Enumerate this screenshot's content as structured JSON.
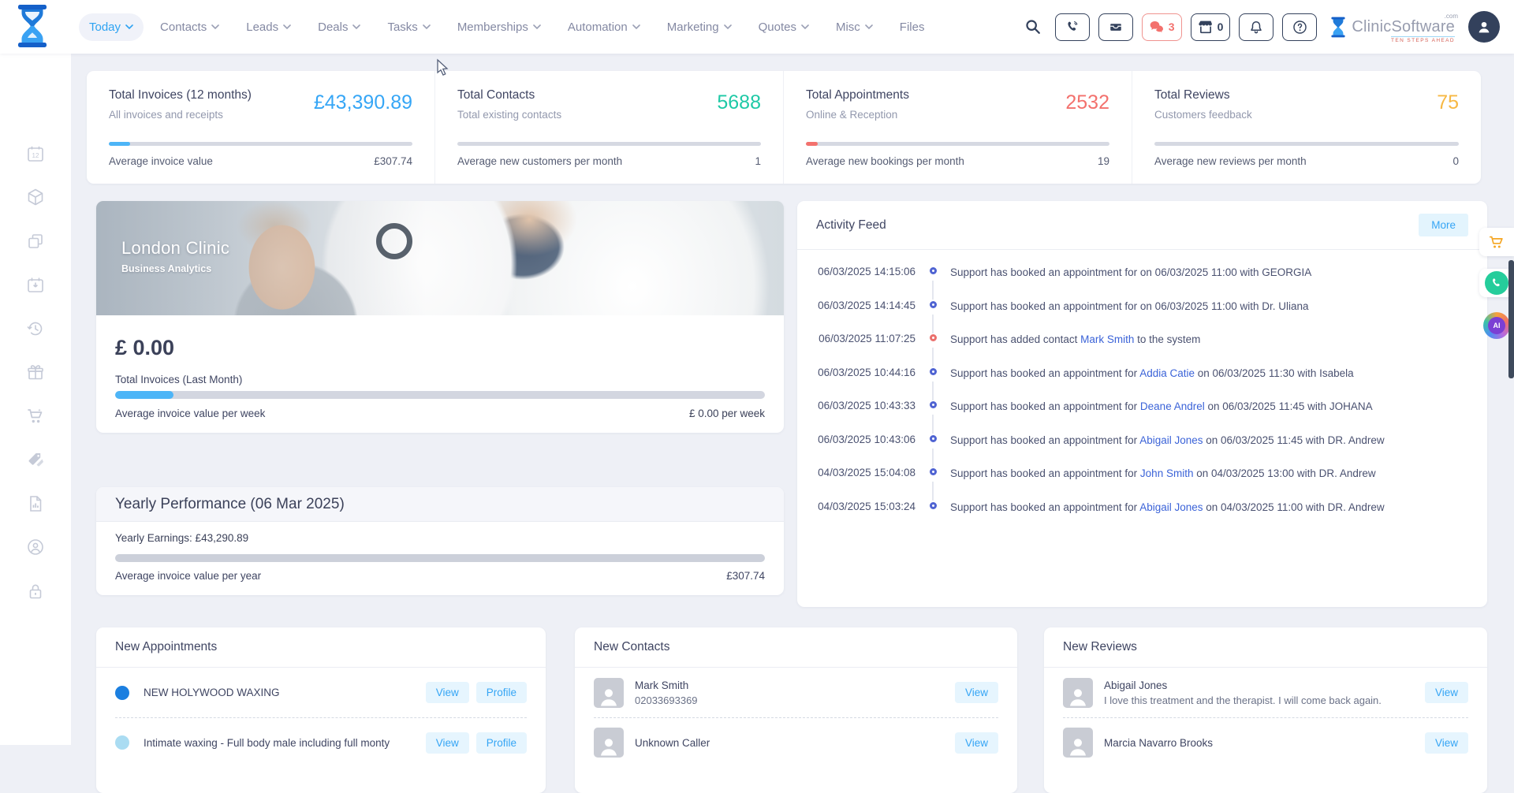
{
  "header": {
    "nav": [
      {
        "label": "Today"
      },
      {
        "label": "Contacts"
      },
      {
        "label": "Leads"
      },
      {
        "label": "Deals"
      },
      {
        "label": "Tasks"
      },
      {
        "label": "Memberships"
      },
      {
        "label": "Automation"
      },
      {
        "label": "Marketing"
      },
      {
        "label": "Quotes"
      },
      {
        "label": "Misc"
      },
      {
        "label": "Files"
      }
    ],
    "chat_badge": "3",
    "shop_badge": "0",
    "brand": {
      "name": "ClinicSoftware",
      "tld": ".com",
      "tagline": "TEN STEPS AHEAD"
    },
    "icons": [
      "search-icon",
      "phone-icon",
      "inbox-icon",
      "chat-icon",
      "shop-icon",
      "bell-icon",
      "help-icon",
      "user-avatar-icon"
    ],
    "accent_color": "#2ea3f2"
  },
  "sidebar": {
    "icons": [
      "calendar-12",
      "package",
      "copy",
      "calendar-import",
      "history",
      "gift",
      "cart",
      "tags",
      "report",
      "account",
      "lock"
    ]
  },
  "stats": {
    "cards": [
      {
        "title": "Total Invoices (12 months)",
        "subtitle": "All invoices and receipts",
        "value": "£43,390.89",
        "value_color": "#36a6f6",
        "bar_pct": 7,
        "bar_color": "#4db5f7",
        "footer_label": "Average invoice value",
        "footer_value": "£307.74"
      },
      {
        "title": "Total Contacts",
        "subtitle": "Total existing contacts",
        "value": "5688",
        "value_color": "#1ec9a6",
        "bar_pct": 0,
        "bar_color": "#1ec9a6",
        "footer_label": "Average new customers per month",
        "footer_value": "1"
      },
      {
        "title": "Total Appointments",
        "subtitle": "Online & Reception",
        "value": "2532",
        "value_color": "#f3716d",
        "bar_pct": 4,
        "bar_color": "#f3716d",
        "footer_label": "Average new bookings per month",
        "footer_value": "19"
      },
      {
        "title": "Total Reviews",
        "subtitle": "Customers feedback",
        "value": "75",
        "value_color": "#f7b844",
        "bar_pct": 0,
        "bar_color": "#f7b844",
        "footer_label": "Average new reviews per month",
        "footer_value": "0"
      }
    ]
  },
  "clinic": {
    "title": "London Clinic",
    "subtitle": "Business Analytics"
  },
  "invoice": {
    "amount": "£ 0.00",
    "label": "Total Invoices (Last Month)",
    "bar_pct": 9,
    "bar_color": "#4db5f7",
    "footer_label": "Average invoice value per week",
    "footer_value": "£ 0.00 per week"
  },
  "yearly": {
    "title": "Yearly Performance (06 Mar 2025)",
    "earnings": "Yearly Earnings: £43,290.89",
    "bar_pct": 0,
    "footer_label": "Average invoice value per year",
    "footer_value": "£307.74"
  },
  "activity": {
    "title": "Activity Feed",
    "more_label": "More",
    "items": [
      {
        "time": "06/03/2025 14:15:06",
        "dot": "#4f63d2",
        "pre": "Support has booked an appointment for on 06/03/2025 11:00 with GEORGIA",
        "link": "",
        "post": ""
      },
      {
        "time": "06/03/2025 14:14:45",
        "dot": "#4f63d2",
        "pre": "Support has booked an appointment for on 06/03/2025 11:00 with Dr. Uliana",
        "link": "",
        "post": ""
      },
      {
        "time": "06/03/2025 11:07:25",
        "dot": "#ea6f6c",
        "pre": "Support has added contact ",
        "link": "Mark Smith",
        "post": " to the system"
      },
      {
        "time": "06/03/2025 10:44:16",
        "dot": "#4f63d2",
        "pre": "Support has booked an appointment for ",
        "link": "Addia Catie",
        "post": " on 06/03/2025 11:30 with Isabela"
      },
      {
        "time": "06/03/2025 10:43:33",
        "dot": "#4f63d2",
        "pre": "Support has booked an appointment for ",
        "link": "Deane Andrel",
        "post": " on 06/03/2025 11:45 with JOHANA"
      },
      {
        "time": "06/03/2025 10:43:06",
        "dot": "#4f63d2",
        "pre": "Support has booked an appointment for ",
        "link": "Abigail Jones",
        "post": " on 06/03/2025 11:45 with DR. Andrew"
      },
      {
        "time": "04/03/2025 15:04:08",
        "dot": "#4f63d2",
        "pre": "Support has booked an appointment for ",
        "link": "John Smith",
        "post": " on 04/03/2025 13:00 with DR. Andrew"
      },
      {
        "time": "04/03/2025 15:03:24",
        "dot": "#4f63d2",
        "pre": "Support has booked an appointment for ",
        "link": "Abigail Jones",
        "post": " on 04/03/2025 11:00 with DR. Andrew"
      }
    ]
  },
  "appointments": {
    "title": "New Appointments",
    "rows": [
      {
        "dot_color": "#1b7fe0",
        "label": "NEW HOLYWOOD WAXING",
        "view_label": "View",
        "profile_label": "Profile"
      },
      {
        "dot_color": "#aadcf2",
        "label": "Intimate waxing - Full body male including full monty",
        "view_label": "View",
        "profile_label": "Profile"
      }
    ]
  },
  "contacts": {
    "title": "New Contacts",
    "rows": [
      {
        "name": "Mark Smith",
        "detail": "02033693369",
        "view_label": "View"
      },
      {
        "name": "Unknown Caller",
        "detail": "",
        "view_label": "View"
      }
    ]
  },
  "reviews": {
    "title": "New Reviews",
    "rows": [
      {
        "name": "Abigail Jones",
        "detail": "I love this treatment and the therapist. I will come back again.",
        "view_label": "View"
      },
      {
        "name": "Marcia Navarro Brooks",
        "detail": "",
        "view_label": "View"
      }
    ]
  },
  "floating": {
    "icons": [
      "cart-icon",
      "whatsapp-phone-icon",
      "ai-icon"
    ],
    "ai_label": "AI"
  }
}
